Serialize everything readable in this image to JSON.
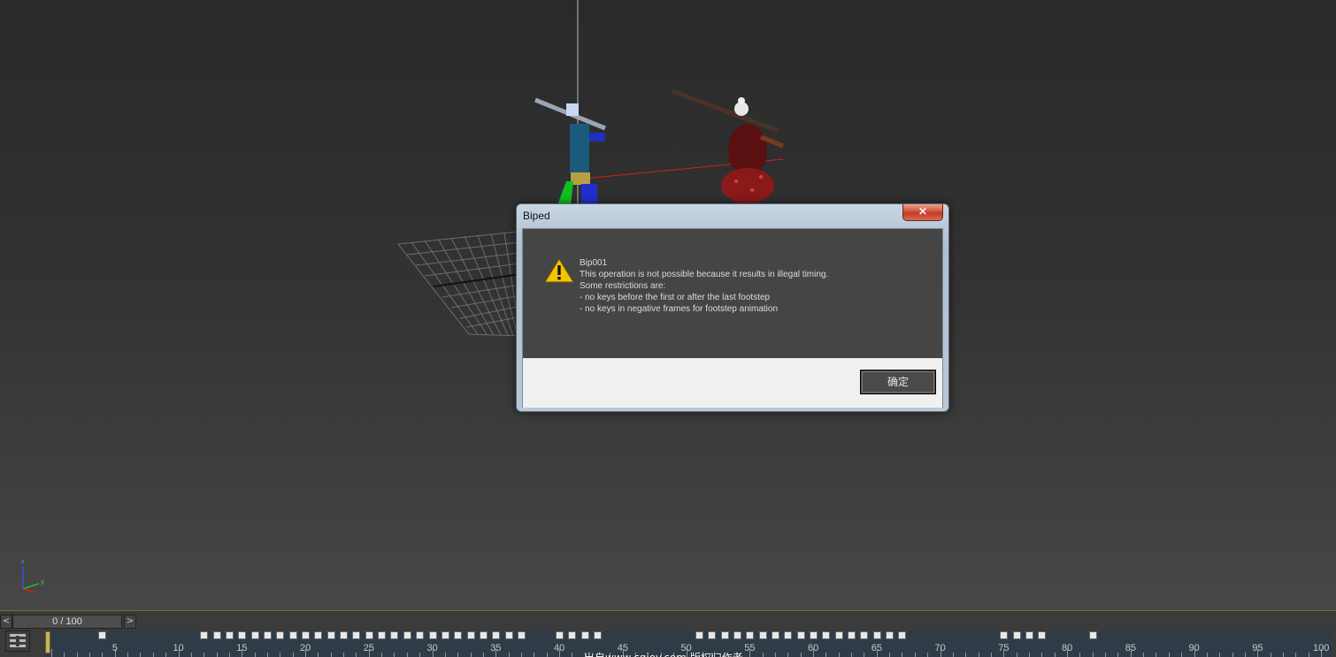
{
  "dialog": {
    "title": "Biped",
    "close_label": "×",
    "icon": "warning-icon",
    "message_lines": [
      "Bip001",
      "This operation is not possible because it results in illegal timing.",
      "Some restrictions are:",
      "- no keys before the first or after the last footstep",
      "- no keys in negative frames for footstep animation"
    ],
    "ok_label": "确定"
  },
  "timeline": {
    "frame_display": "0 / 100",
    "prev_label": "<",
    "next_label": ">",
    "tick_labels": [
      "5",
      "10",
      "15",
      "20",
      "25",
      "30",
      "35",
      "40",
      "45",
      "50",
      "55",
      "60",
      "65",
      "70",
      "75",
      "80",
      "85",
      "90",
      "95",
      "100"
    ],
    "watermark": "出自www.cgjoy.com 版权归作者"
  },
  "colors": {
    "viewport_bg": "#333333",
    "dialog_message_bg": "#454545",
    "timeline_track": "#2f3c48",
    "close_red": "#c13a22",
    "warning_yellow": "#f5c400"
  }
}
